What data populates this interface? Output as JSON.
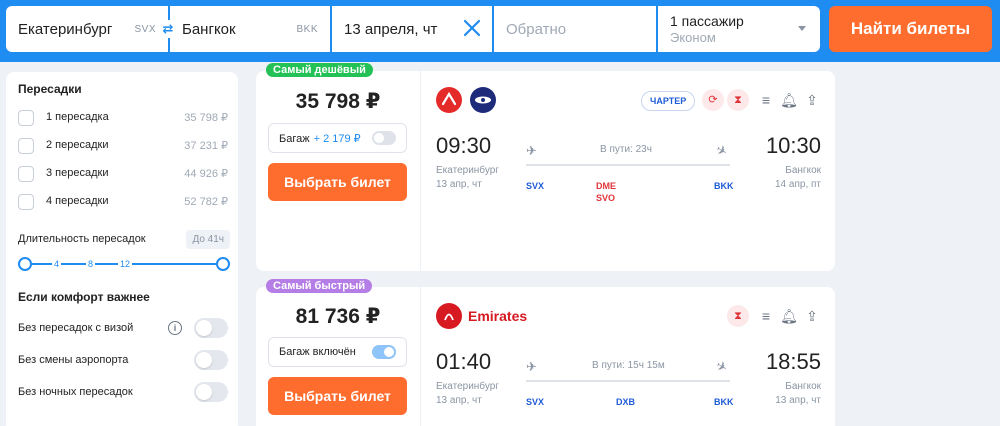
{
  "search": {
    "from_city": "Екатеринбург",
    "from_code": "SVX",
    "to_city": "Бангкок",
    "to_code": "BKK",
    "date": "13 апреля, чт",
    "return_placeholder": "Обратно",
    "passengers": "1 пассажир",
    "class": "Эконом",
    "find_button": "Найти билеты"
  },
  "filters": {
    "transfers_title": "Пересадки",
    "transfers": [
      {
        "label": "1 пересадка",
        "price": "35 798 ₽"
      },
      {
        "label": "2 пересадки",
        "price": "37 231 ₽"
      },
      {
        "label": "3 пересадки",
        "price": "44 926 ₽"
      },
      {
        "label": "4 пересадки",
        "price": "52 782 ₽"
      }
    ],
    "duration_label": "Длительность пересадок",
    "duration_value": "До 41ч",
    "slider_ticks": [
      "4",
      "8",
      "12"
    ],
    "comfort_title": "Если комфорт важнее",
    "comfort_options": [
      {
        "label": "Без пересадок с визой"
      },
      {
        "label": "Без смены аэропорта"
      },
      {
        "label": "Без ночных пересадок"
      }
    ]
  },
  "tickets": [
    {
      "tag": "Самый дешёвый",
      "price": "35 798 ₽",
      "baggage_label": "Багаж",
      "baggage_price": "+ 2 179 ₽",
      "baggage_included": false,
      "choose_label": "Выбрать билет",
      "charter_label": "ЧАРТЕР",
      "dep_time": "09:30",
      "dep_city": "Екатеринбург",
      "dep_date": "13 апр, чт",
      "arr_time": "10:30",
      "arr_city": "Бангкок",
      "arr_date": "14 апр, пт",
      "in_transit": "В пути: 23ч",
      "dep_code": "SVX",
      "stop1": "DME",
      "stop2": "SVO",
      "arr_code": "BKK"
    },
    {
      "tag": "Самый быстрый",
      "price": "81 736 ₽",
      "baggage_label": "Багаж включён",
      "baggage_included": true,
      "choose_label": "Выбрать билет",
      "airline": "Emirates",
      "dep_time": "01:40",
      "dep_city": "Екатеринбург",
      "dep_date": "13 апр, чт",
      "arr_time": "18:55",
      "arr_city": "Бангкок",
      "arr_date": "13 апр, чт",
      "in_transit": "В пути: 15ч 15м",
      "dep_code": "SVX",
      "stop1": "DXB",
      "arr_code": "BKK"
    }
  ],
  "colors": {
    "header": "#1e8cf0",
    "cta": "#ff6d2e",
    "cheap_tag": "#23c156",
    "fast_tag": "#b57ee6"
  }
}
